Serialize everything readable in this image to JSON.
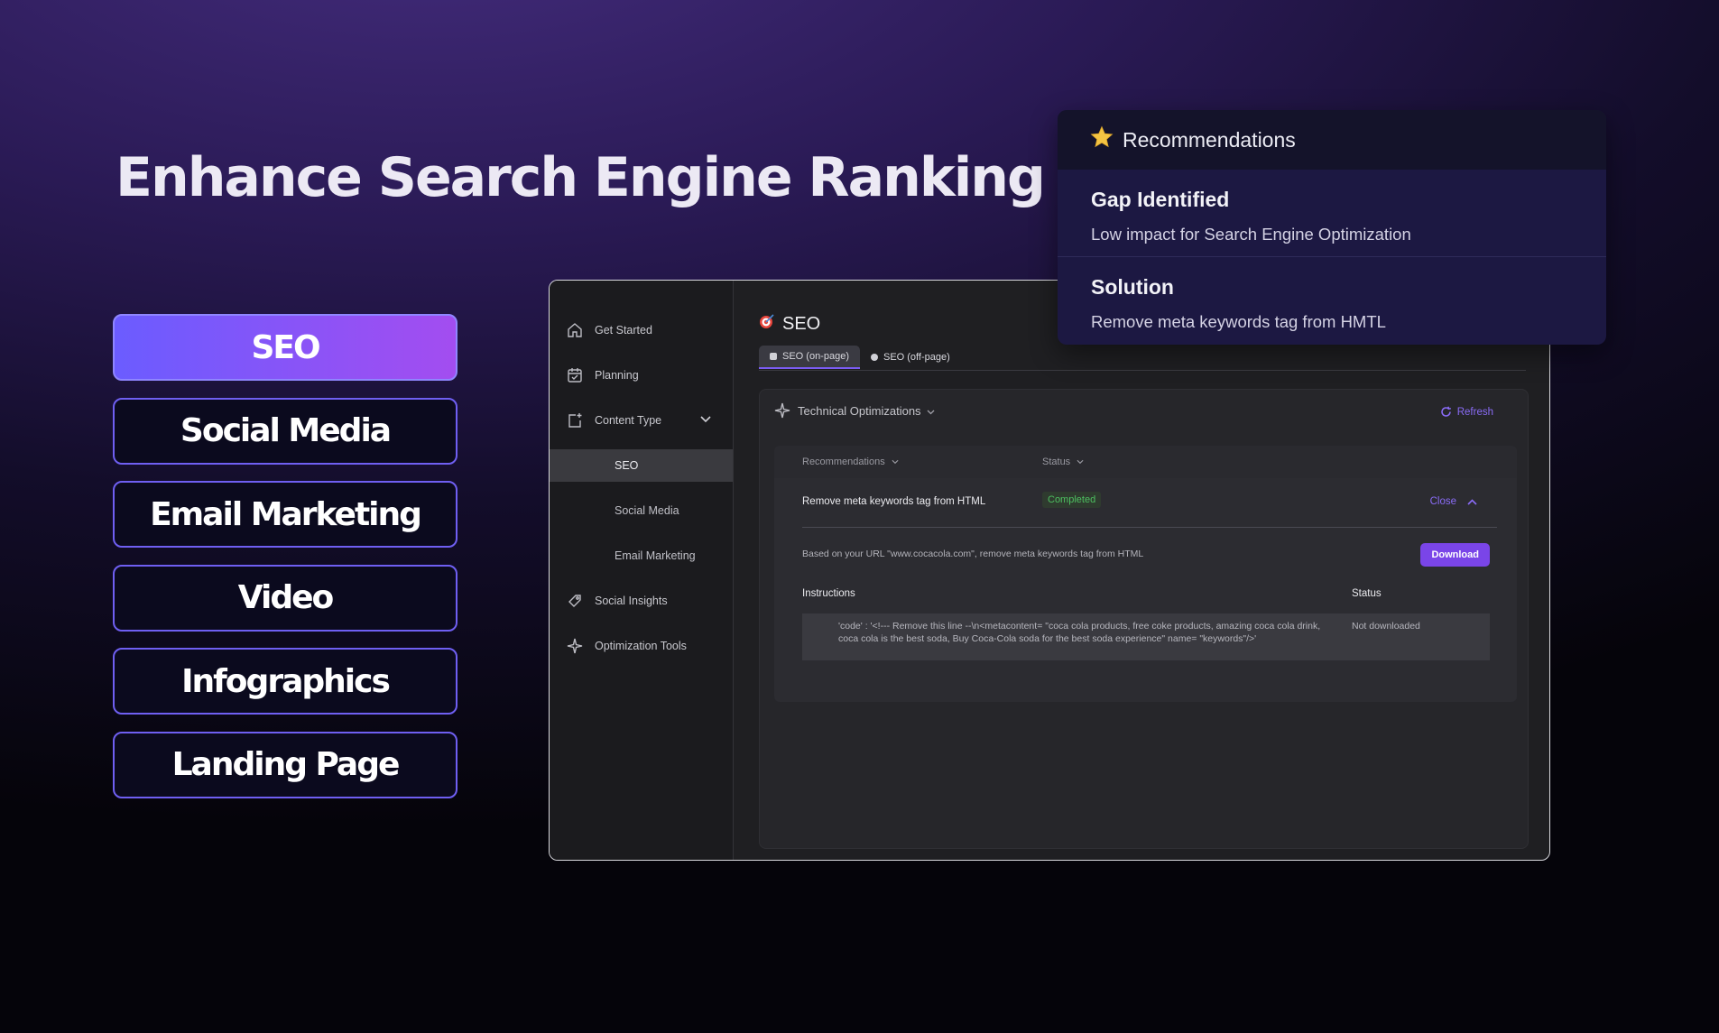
{
  "hero": {
    "title": "Enhance Search Engine Ranking"
  },
  "categories": [
    {
      "label": "SEO",
      "active": true
    },
    {
      "label": "Social Media",
      "active": false
    },
    {
      "label": "Email Marketing",
      "active": false
    },
    {
      "label": "Video",
      "active": false
    },
    {
      "label": "Infographics",
      "active": false
    },
    {
      "label": "Landing Page",
      "active": false
    }
  ],
  "sidebar": {
    "items": [
      {
        "label": "Get Started",
        "icon": "home-icon"
      },
      {
        "label": "Planning",
        "icon": "calendar-check-icon"
      },
      {
        "label": "Content Type",
        "icon": "add-document-icon"
      },
      {
        "label": "Social Insights",
        "icon": "tag-icon"
      },
      {
        "label": "Optimization Tools",
        "icon": "sparkle-icon"
      }
    ],
    "subitems": [
      {
        "label": "SEO",
        "active": true
      },
      {
        "label": "Social Media",
        "active": false
      },
      {
        "label": "Email Marketing",
        "active": false
      }
    ]
  },
  "main": {
    "title": "SEO",
    "tabs": [
      {
        "label": "SEO (on-page)",
        "active": true
      },
      {
        "label": "SEO (off-page)",
        "active": false
      }
    ],
    "panel": {
      "title": "Technical Optimizations",
      "refresh_label": "Refresh",
      "columns": {
        "recommendations": "Recommendations",
        "status": "Status"
      },
      "row": {
        "recommendation": "Remove meta keywords tag from HTML",
        "status": "Completed",
        "close_label": "Close"
      },
      "detail": {
        "description": "Based on your URL \"www.cocacola.com\", remove meta keywords tag from HTML",
        "download_label": "Download",
        "instructions_header": "Instructions",
        "status_header": "Status",
        "code": "'code' : '<!--- Remove this line --\\n<metacontent= \"coca cola products, free coke products, amazing coca cola drink, coca cola is the best soda, Buy Coca-Cola soda for the best soda experience\" name= \"keywords\"/>'",
        "code_status": "Not downloaded"
      }
    }
  },
  "recommendations_card": {
    "title": "Recommendations",
    "gap": {
      "title": "Gap Identified",
      "text": "Low impact for Search Engine Optimization"
    },
    "solution": {
      "title": "Solution",
      "text": "Remove meta keywords tag from HMTL"
    }
  },
  "colors": {
    "accent": "#7a45e8",
    "gradient_start": "#6b5cff",
    "gradient_end": "#a34df0",
    "success": "#4dc060"
  }
}
